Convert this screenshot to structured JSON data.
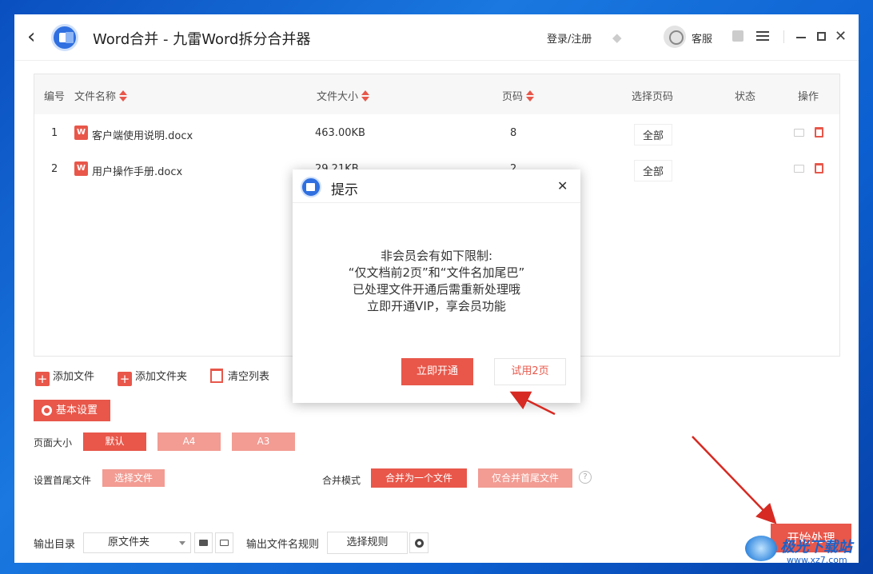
{
  "app": {
    "title": "Word合并 - 九雷Word拆分合并器",
    "login": "登录/注册",
    "service": "客服"
  },
  "table": {
    "headers": {
      "index": "编号",
      "name": "文件名称",
      "size": "文件大小",
      "pages": "页码",
      "select_pages": "选择页码",
      "status": "状态",
      "actions": "操作"
    },
    "rows": [
      {
        "index": "1",
        "name": "客户端使用说明.docx",
        "size": "463.00KB",
        "pages": "8",
        "select": "全部"
      },
      {
        "index": "2",
        "name": "用户操作手册.docx",
        "size": "29.21KB",
        "pages": "2",
        "select": "全部"
      }
    ],
    "file_icon": "W"
  },
  "tools": {
    "add_file": "添加文件",
    "add_folder": "添加文件夹",
    "clear_list": "清空列表"
  },
  "settings": {
    "basic": "基本设置",
    "page_size_label": "页面大小",
    "page_sizes": [
      "默认",
      "A4",
      "A3"
    ],
    "head_tail_label": "设置首尾文件",
    "choose_file": "选择文件",
    "merge_mode_label": "合并模式",
    "merge_modes": [
      "合并为一个文件",
      "仅合并首尾文件"
    ],
    "help": "?"
  },
  "output": {
    "dir_label": "输出目录",
    "dir_value": "原文件夹",
    "name_rule_label": "输出文件名规则",
    "choose_rule": "选择规则",
    "start": "开始处理"
  },
  "dialog": {
    "title": "提示",
    "lines": [
      "非会员会有如下限制:",
      "“仅文档前2页”和“文件名加尾巴”",
      "已处理文件开通后需重新处理哦",
      "立即开通VIP，享会员功能"
    ],
    "primary": "立即开通",
    "secondary": "试用2页"
  },
  "watermark": {
    "text": "极光下载站",
    "url": "www.xz7.com"
  },
  "colors": {
    "accent": "#e8574a",
    "accent_light": "#f29c93",
    "desktop": "#1a78e0"
  }
}
